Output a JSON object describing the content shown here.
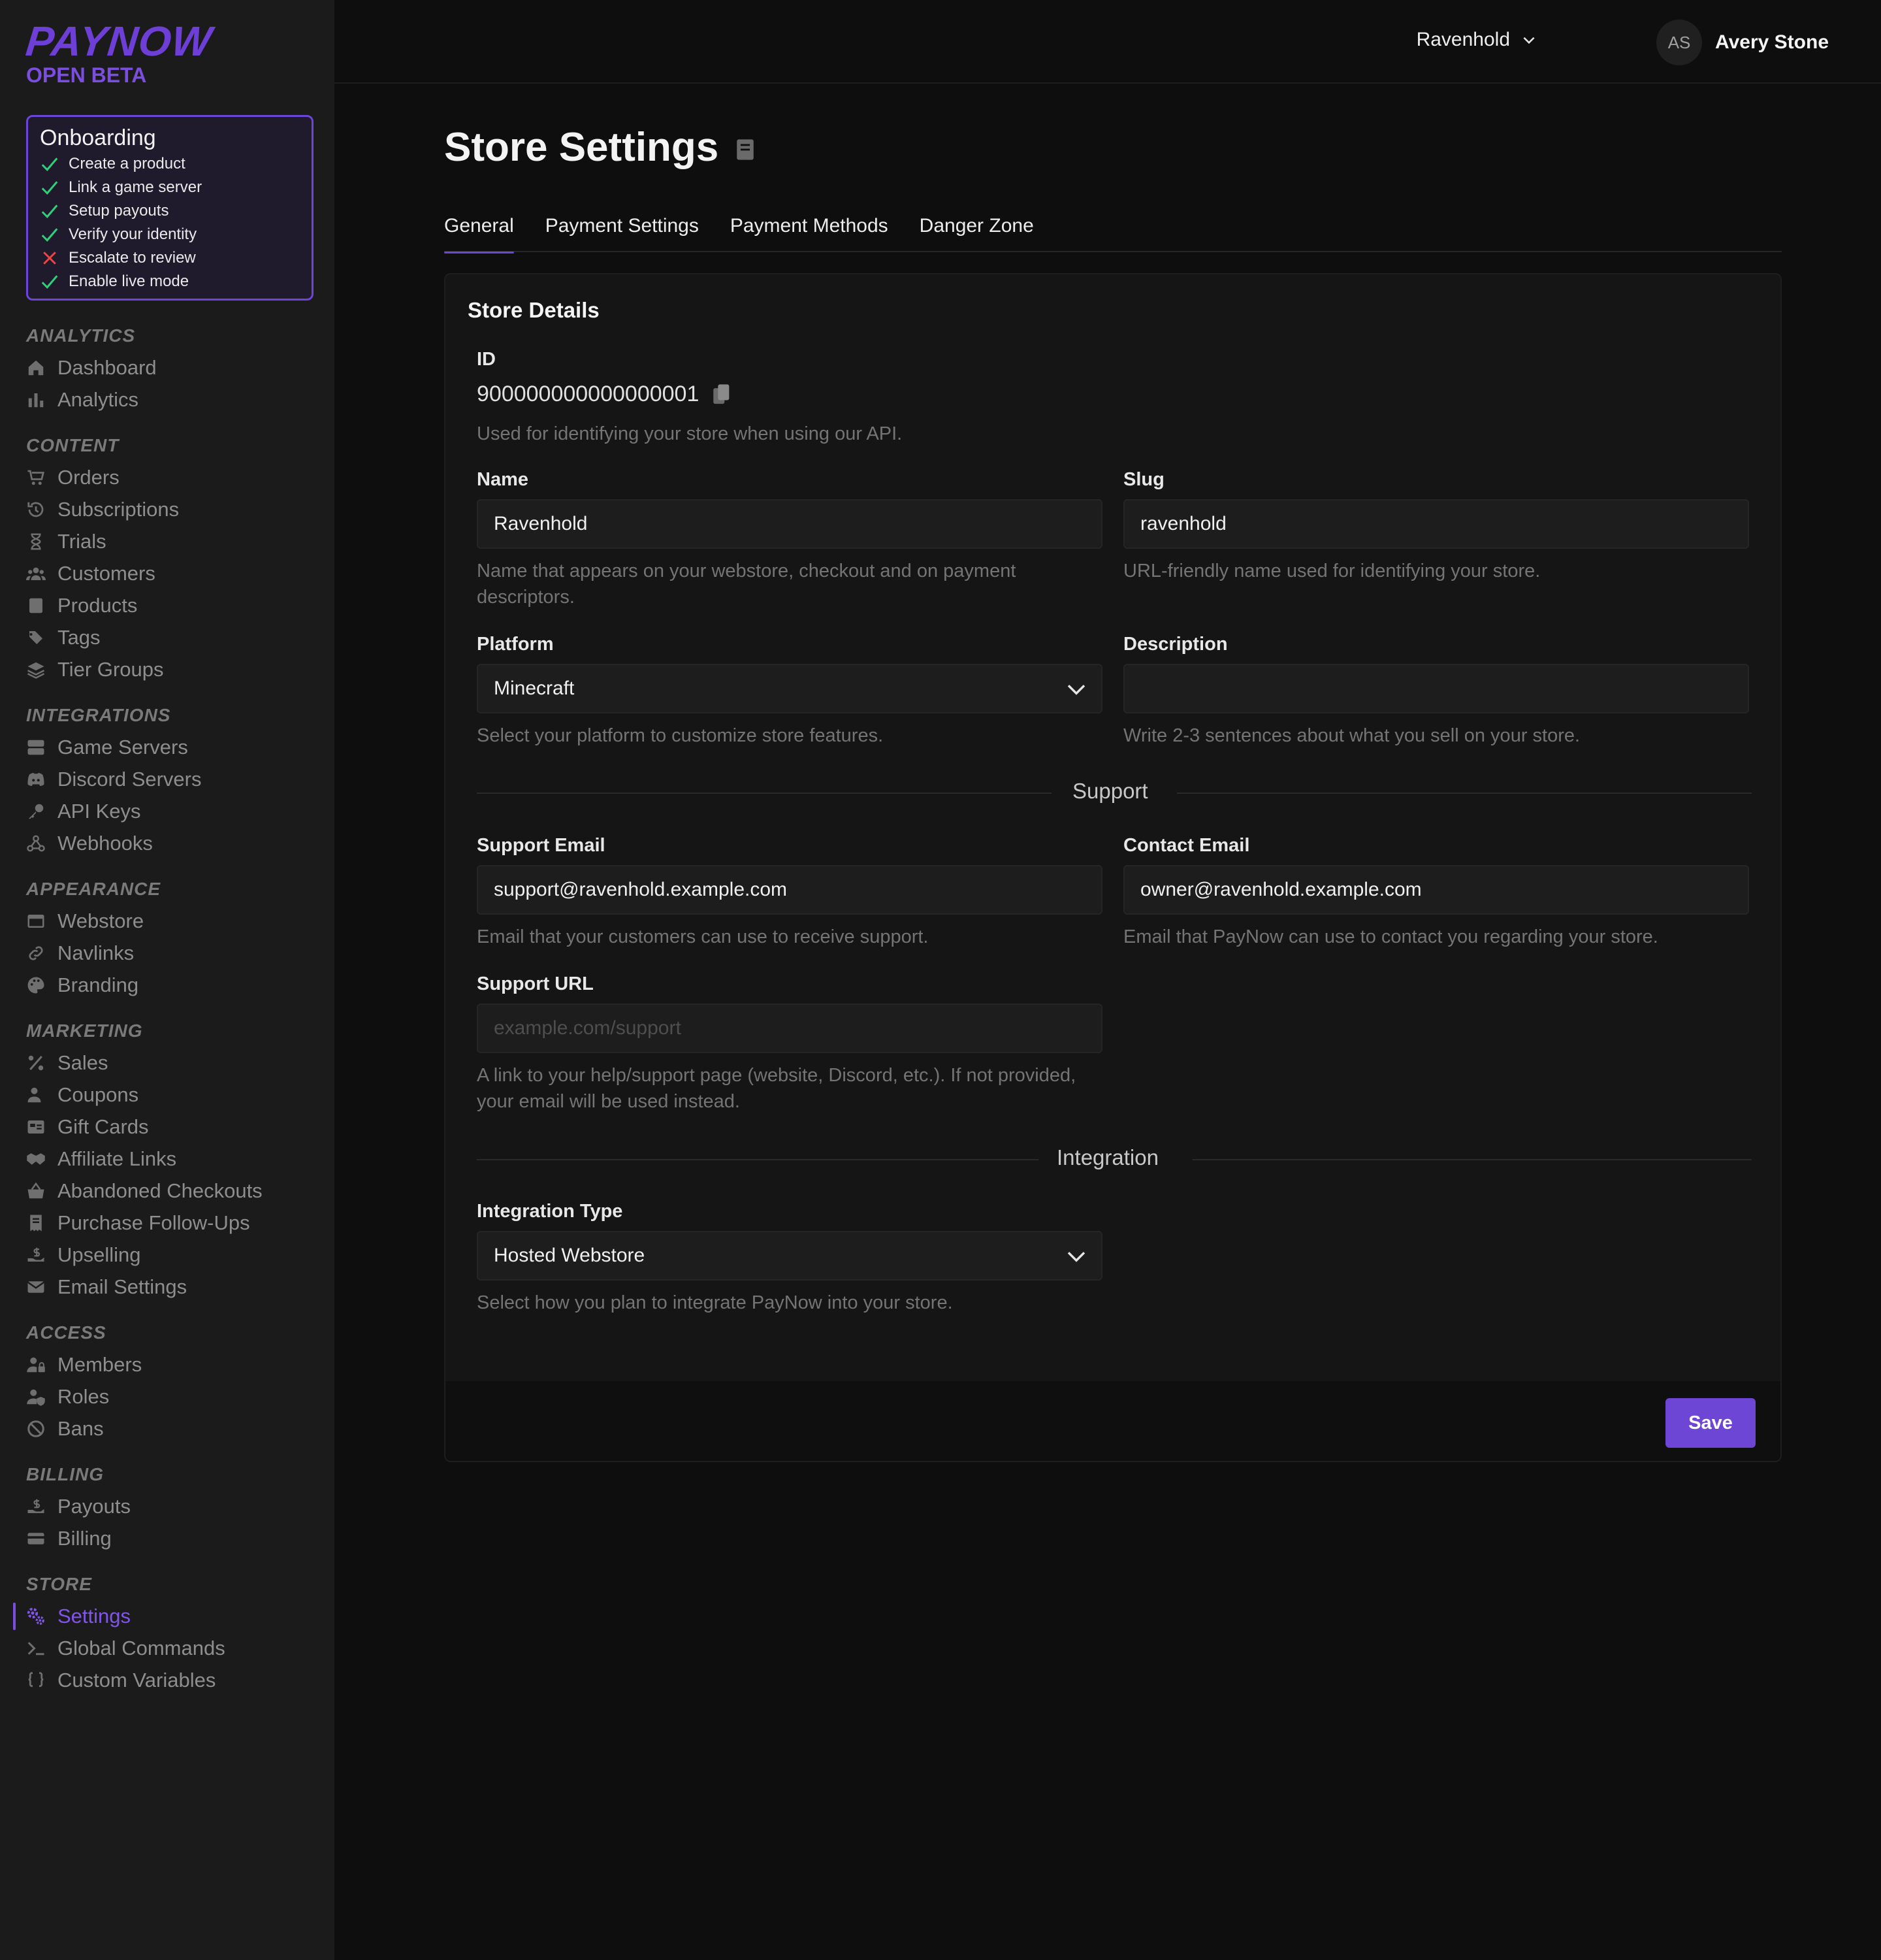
{
  "brand": {
    "name": "PAYNOW",
    "tag": "OPEN BETA",
    "accent": "#6d46d6"
  },
  "onboarding": {
    "title": "Onboarding",
    "items": [
      {
        "label": "Create a product",
        "status": "done"
      },
      {
        "label": "Link a game server",
        "status": "done"
      },
      {
        "label": "Setup payouts",
        "status": "done"
      },
      {
        "label": "Verify your identity",
        "status": "done"
      },
      {
        "label": "Escalate to review",
        "status": "failed"
      },
      {
        "label": "Enable live mode",
        "status": "done"
      }
    ]
  },
  "nav": {
    "analytics": {
      "title": "ANALYTICS",
      "items": [
        "Dashboard",
        "Analytics"
      ]
    },
    "content": {
      "title": "CONTENT",
      "items": [
        "Orders",
        "Subscriptions",
        "Trials",
        "Customers",
        "Products",
        "Tags",
        "Tier Groups"
      ]
    },
    "integrations": {
      "title": "INTEGRATIONS",
      "items": [
        "Game Servers",
        "Discord Servers",
        "API Keys",
        "Webhooks"
      ]
    },
    "appearance": {
      "title": "APPEARANCE",
      "items": [
        "Webstore",
        "Navlinks",
        "Branding"
      ]
    },
    "marketing": {
      "title": "MARKETING",
      "items": [
        "Sales",
        "Coupons",
        "Gift Cards",
        "Affiliate Links",
        "Abandoned Checkouts",
        "Purchase Follow-Ups",
        "Upselling",
        "Email Settings"
      ]
    },
    "access": {
      "title": "ACCESS",
      "items": [
        "Members",
        "Roles",
        "Bans"
      ]
    },
    "billing": {
      "title": "BILLING",
      "items": [
        "Payouts",
        "Billing"
      ]
    },
    "store": {
      "title": "STORE",
      "items": [
        "Settings",
        "Global Commands",
        "Custom Variables"
      ]
    }
  },
  "topbar": {
    "store_name": "Ravenhold",
    "user_initials": "AS",
    "user_name": "Avery Stone"
  },
  "page": {
    "title": "Store Settings",
    "tabs": [
      "General",
      "Payment Settings",
      "Payment Methods",
      "Danger Zone"
    ],
    "active_tab": "General"
  },
  "store_details": {
    "title": "Store Details",
    "id_label": "ID",
    "id_value": "900000000000000001",
    "id_help": "Used for identifying your store when using our API.",
    "name_label": "Name",
    "name_value": "Ravenhold",
    "name_help": "Name that appears on your webstore, checkout and on payment descriptors.",
    "slug_label": "Slug",
    "slug_value": "ravenhold",
    "slug_help": "URL-friendly name used for identifying your store.",
    "platform_label": "Platform",
    "platform_value": "Minecraft",
    "platform_help": "Select your platform to customize store features.",
    "description_label": "Description",
    "description_value": "",
    "description_help": "Write 2-3 sentences about what you sell on your store.",
    "support_divider": "Support",
    "support_email_label": "Support Email",
    "support_email_value": "support@ravenhold.example.com",
    "support_email_help": "Email that your customers can use to receive support.",
    "contact_email_label": "Contact Email",
    "contact_email_value": "owner@ravenhold.example.com",
    "contact_email_help": "Email that PayNow can use to contact you regarding your store.",
    "support_url_label": "Support URL",
    "support_url_placeholder": "example.com/support",
    "support_url_help": "A link to your help/support page (website, Discord, etc.). If not provided, your email will be used instead.",
    "integration_divider": "Integration",
    "integration_type_label": "Integration Type",
    "integration_type_value": "Hosted Webstore",
    "integration_type_help": "Select how you plan to integrate PayNow into your store.",
    "save_label": "Save"
  }
}
